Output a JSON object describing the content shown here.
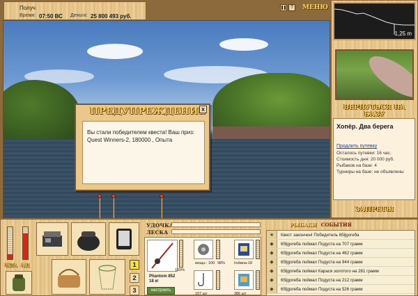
{
  "topbar": {
    "user": "Получ",
    "time_label": "Время:",
    "time_value": "07:50 ВС",
    "money_label": "Деньги:",
    "money_value": "25 800 493 руб."
  },
  "menu": {
    "pause_icon": "pause-icon",
    "help_icon": "?",
    "label": "МЕНЮ"
  },
  "minimap": {
    "depth": "1,25 m"
  },
  "location": {
    "return_label": "ВЕРНУТЬСЯ НА БАЗУ",
    "name": "Хопёр. Два берега",
    "extend_link": "Продлить путевку",
    "remaining": "Осталось путевки: 16 час.",
    "cost": "Стоимость дня: 20 000 руб.",
    "fishers": "Рыбаков на базе: 4",
    "tournaments": "Турниры на базе: не объявлены",
    "bans_label": "ЗАПРЕТЫ"
  },
  "dialog": {
    "title": "ПРЕДУПРЕЖДЕНИЕ",
    "close": "x",
    "message": "Вы стали победителем квеста! Ваш приз: Quest Winners-2, 180000 , Опыта"
  },
  "gauges": {
    "left_label": "ЕДА",
    "right_label": "АД",
    "food_level": 0.15,
    "alc_level": 0.8
  },
  "slots": {
    "numbers": [
      "1",
      "2",
      "3"
    ]
  },
  "equipment": {
    "rod_label": "УДОЧКА",
    "line_label": "ЛЕСКА",
    "rod_name": "Phantom 852",
    "rod_weight": "18 кг",
    "rod_condition": "100%",
    "reel_info": "мощн.: 100",
    "reel_pct": "98%",
    "bait_name": "Indiana-18",
    "hook_info": "107 шт",
    "lure_info": "386 шт",
    "setup_button": "настроить"
  },
  "events": {
    "tab_fishers": "РЫБАКИ",
    "tab_events": "СОБЫТИЯ",
    "items": [
      {
        "icon": "star-icon",
        "text": "Квест закончен! Победитель 65ljgoreба"
      },
      {
        "icon": "fish-icon",
        "text": "65ljgoreба поймал Подуста на 707 грамм"
      },
      {
        "icon": "fish-icon",
        "text": "65ljgoreба поймал Подуста на 462 грамм"
      },
      {
        "icon": "fish-icon",
        "text": "65ljgoreба поймал Подуста на 944 грамм"
      },
      {
        "icon": "fish-icon",
        "text": "65ljgoreба поймал Карася золотого на 281 грамм"
      },
      {
        "icon": "fish-icon",
        "text": "65ljgoreба поймал Подуста на 212 грамм"
      },
      {
        "icon": "fish-icon",
        "text": "65ljgoreба поймал Подуста на 526 грамм"
      }
    ]
  }
}
